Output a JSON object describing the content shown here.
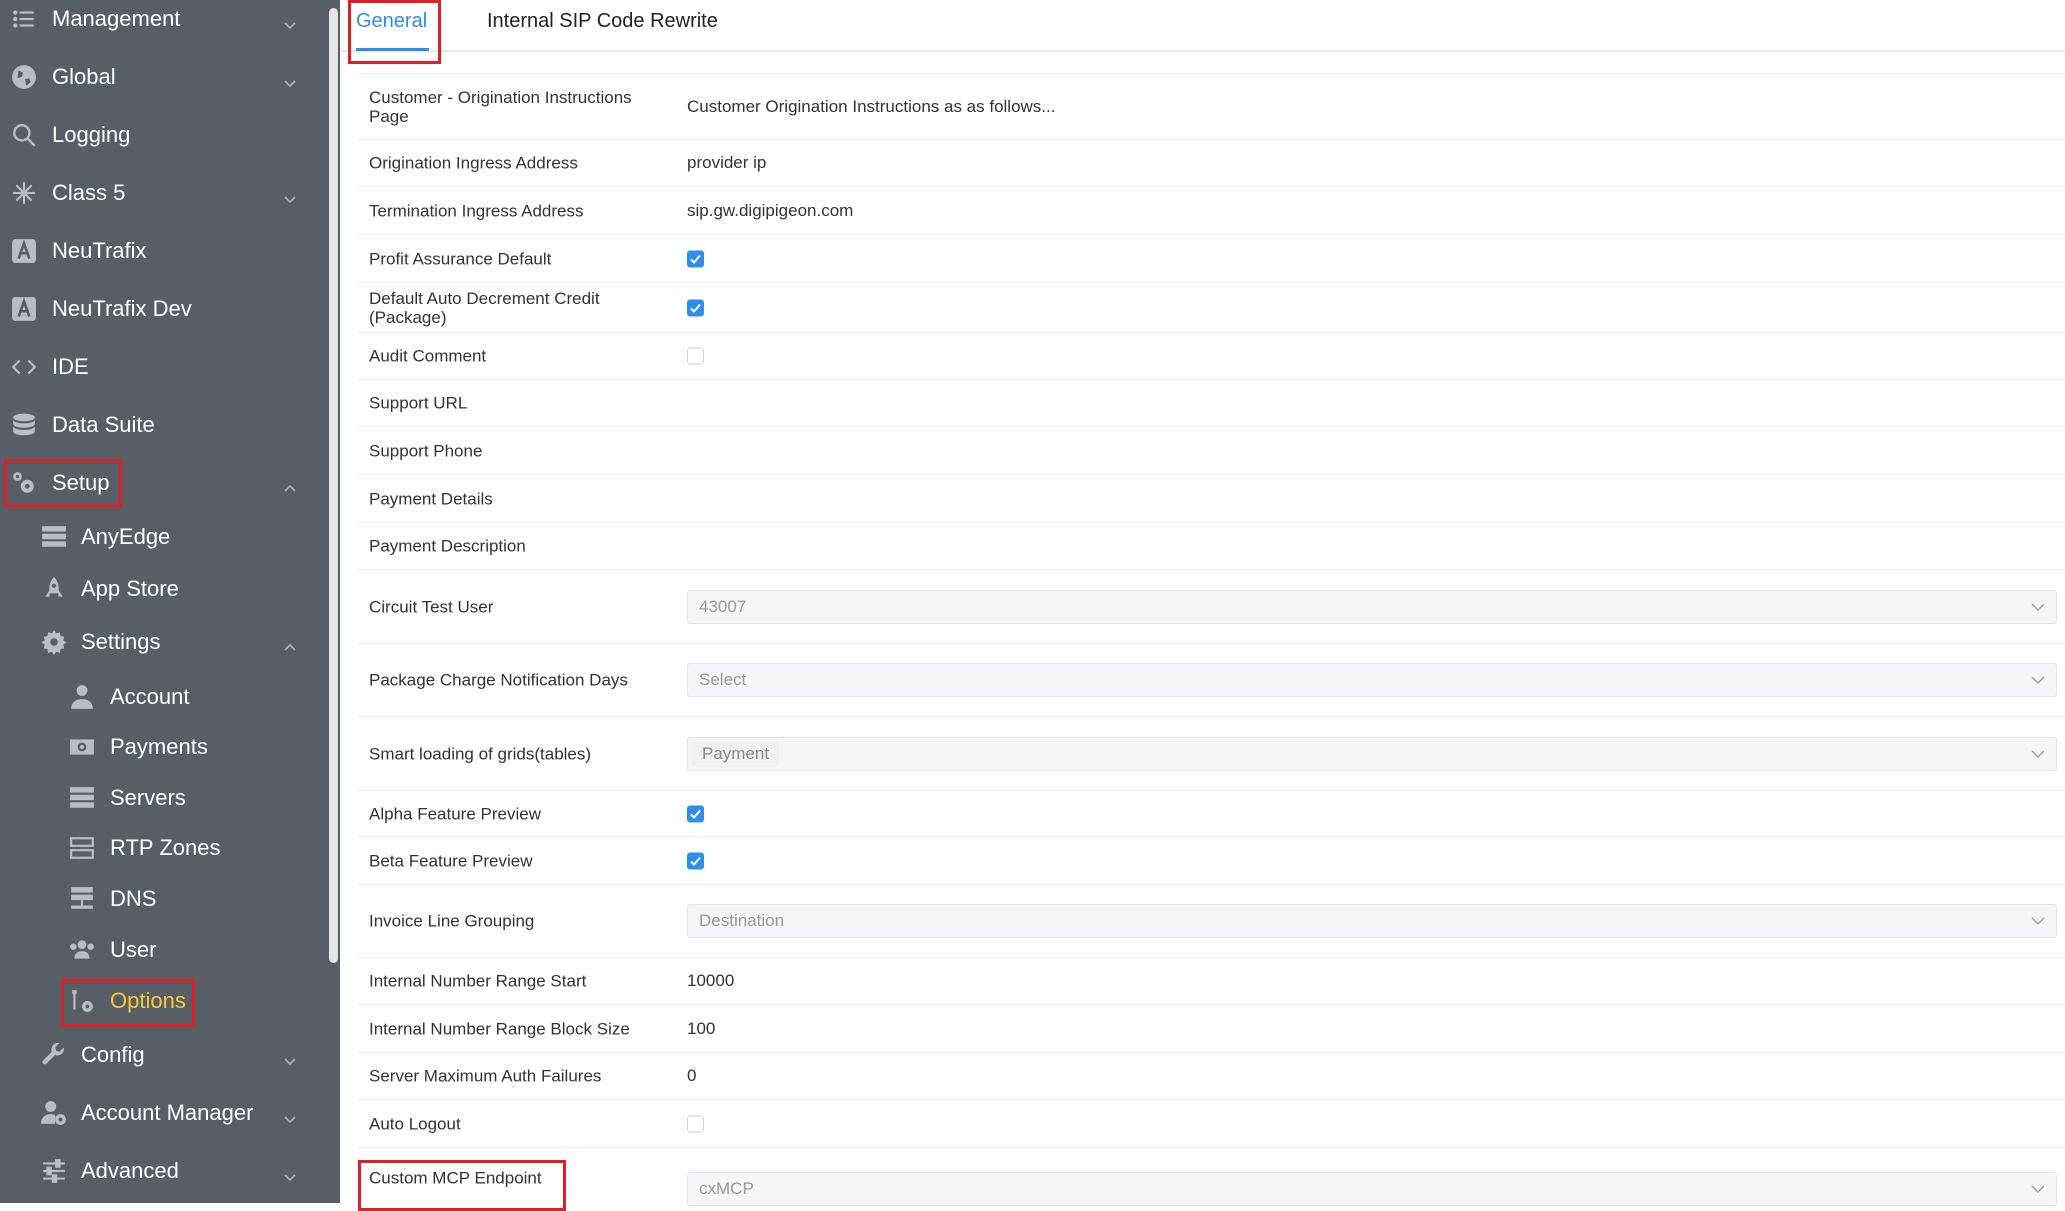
{
  "sidebar": {
    "management": "Management",
    "global": "Global",
    "logging": "Logging",
    "class5": "Class 5",
    "neutrafix": "NeuTrafix",
    "neutrafix_dev": "NeuTrafix Dev",
    "ide": "IDE",
    "data_suite": "Data Suite",
    "setup": "Setup",
    "anyedge": "AnyEdge",
    "app_store": "App Store",
    "settings": "Settings",
    "account": "Account",
    "payments": "Payments",
    "servers": "Servers",
    "rtp_zones": "RTP Zones",
    "dns": "DNS",
    "user": "User",
    "options": "Options",
    "config": "Config",
    "account_manager": "Account Manager",
    "advanced": "Advanced"
  },
  "tabs": {
    "general": "General",
    "sip_rewrite": "Internal SIP Code Rewrite"
  },
  "form": {
    "rows": [
      {
        "label": "Customer - Origination Instructions Page",
        "value": "Customer Origination Instructions as as follows..."
      },
      {
        "label": "Origination Ingress Address",
        "value": "provider ip"
      },
      {
        "label": "Termination Ingress Address",
        "value": "sip.gw.digipigeon.com"
      },
      {
        "label": "Profit Assurance Default",
        "checked": true
      },
      {
        "label": "Default Auto Decrement Credit (Package)",
        "checked": true
      },
      {
        "label": "Audit Comment",
        "checked": false
      },
      {
        "label": "Support URL",
        "value": ""
      },
      {
        "label": "Support Phone",
        "value": ""
      },
      {
        "label": "Payment Details",
        "value": ""
      },
      {
        "label": "Payment Description",
        "value": ""
      },
      {
        "label": "Circuit Test User",
        "value": "43007"
      },
      {
        "label": "Package Charge Notification Days",
        "placeholder": "Select"
      },
      {
        "label": "Smart loading of grids(tables)",
        "value": "Payment"
      },
      {
        "label": "Alpha Feature Preview",
        "checked": true
      },
      {
        "label": "Beta Feature Preview",
        "checked": true
      },
      {
        "label": "Invoice Line Grouping",
        "value": "Destination"
      },
      {
        "label": "Internal Number Range Start",
        "value": "10000"
      },
      {
        "label": "Internal Number Range Block Size",
        "value": "100"
      },
      {
        "label": "Server Maximum Auth Failures",
        "value": "0"
      },
      {
        "label": "Auto Logout",
        "checked": false
      },
      {
        "label": "Custom MCP Endpoint",
        "value": "cxMCP"
      }
    ]
  },
  "colors": {
    "sidebar_bg": "#585e65",
    "accent": "#2f8ee8",
    "active_text": "#f6c842",
    "highlight": "#dd1f26"
  }
}
